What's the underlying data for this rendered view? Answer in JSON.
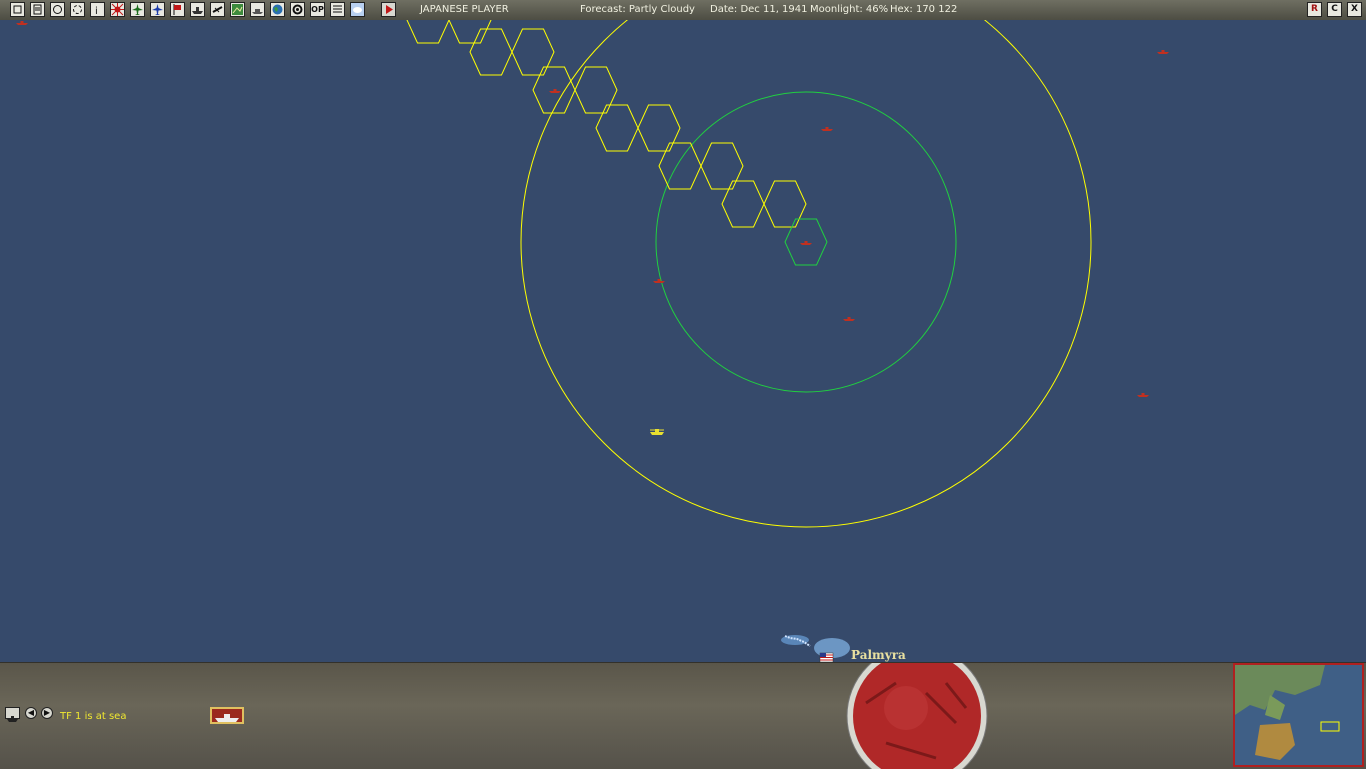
{
  "toolbar": {
    "icons": [
      "new-icon",
      "notes-icon",
      "refresh-icon",
      "cycle-icon",
      "info-icon",
      "japanese-flag-icon",
      "aircraft-icon",
      "air-unit-icon",
      "flag-icon",
      "ship-icon",
      "airplane-icon",
      "map-icon",
      "fleet-icon",
      "globe-icon",
      "settings-icon",
      "op-icon",
      "list-icon",
      "weather-icon",
      "play-icon"
    ],
    "op_label": "OP",
    "player": "JAPANESE PLAYER",
    "forecast": "Forecast: Partly Cloudy",
    "date": "Date: Dec 11, 1941",
    "moonlight": "Moonlight: 46%",
    "hex": "Hex: 170 122",
    "right_icons": [
      "reports-icon",
      "combat-icon",
      "close-icon"
    ],
    "right_labels": [
      "R",
      "C",
      "X"
    ]
  },
  "map": {
    "base_label": "Palmyra",
    "base_nation": "USA"
  },
  "bottom": {
    "status_text": "TF 1 is at sea"
  },
  "colors": {
    "ocean": "#364a6b",
    "range_outer": "#ffff00",
    "range_inner": "#20d040",
    "enemy_ship": "#c03020",
    "tf_button": "#9b2a1e"
  }
}
